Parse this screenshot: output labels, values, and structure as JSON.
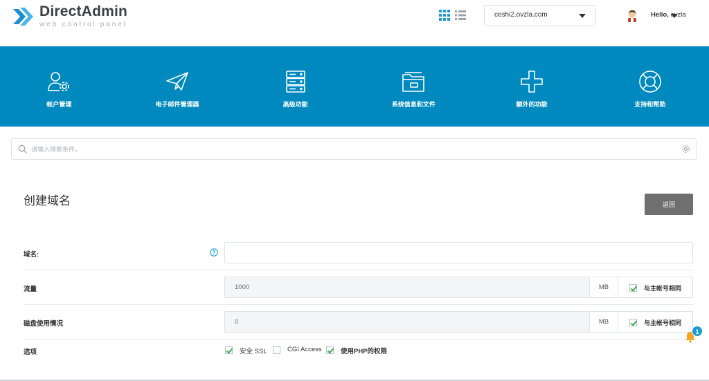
{
  "header": {
    "brand_title": "DirectAdmin",
    "brand_subtitle": "web control panel",
    "domain_selected": "ceshi2.ovzla.com",
    "greeting": "Hello,",
    "username": "ovzla"
  },
  "nav": {
    "items": [
      {
        "label": "帐户管理",
        "icon": "user-gear-icon"
      },
      {
        "label": "电子邮件管理器",
        "icon": "paper-plane-icon"
      },
      {
        "label": "高级功能",
        "icon": "server-stack-icon"
      },
      {
        "label": "系统信息和文件",
        "icon": "folder-icon"
      },
      {
        "label": "额外的功能",
        "icon": "plus-icon"
      },
      {
        "label": "支持和帮助",
        "icon": "lifebuoy-icon"
      }
    ]
  },
  "search": {
    "placeholder": "请输入搜索条件。"
  },
  "page": {
    "title": "创建域名",
    "back_label": "返回"
  },
  "form": {
    "domain_label": "域名:",
    "domain_value": "",
    "bandwidth_label": "流量",
    "bandwidth_value": "1000",
    "bandwidth_unit": "MB",
    "bandwidth_same_label": "与主帐号相同",
    "bandwidth_same_checked": true,
    "disk_label": "磁盘使用情况",
    "disk_value": "0",
    "disk_unit": "MB",
    "disk_same_label": "与主帐号相同",
    "disk_same_checked": true,
    "options_label": "选项",
    "options": [
      {
        "label": "安全 SSL",
        "checked": true
      },
      {
        "label": "CGI Access",
        "checked": false
      },
      {
        "label": "使用PHP的权限",
        "checked": true
      }
    ]
  },
  "notifications": {
    "count": "1"
  },
  "colors": {
    "nav_bg": "#0089be",
    "accent": "#1a9bd6",
    "check": "#3eaa4a",
    "bell": "#f5a623"
  }
}
